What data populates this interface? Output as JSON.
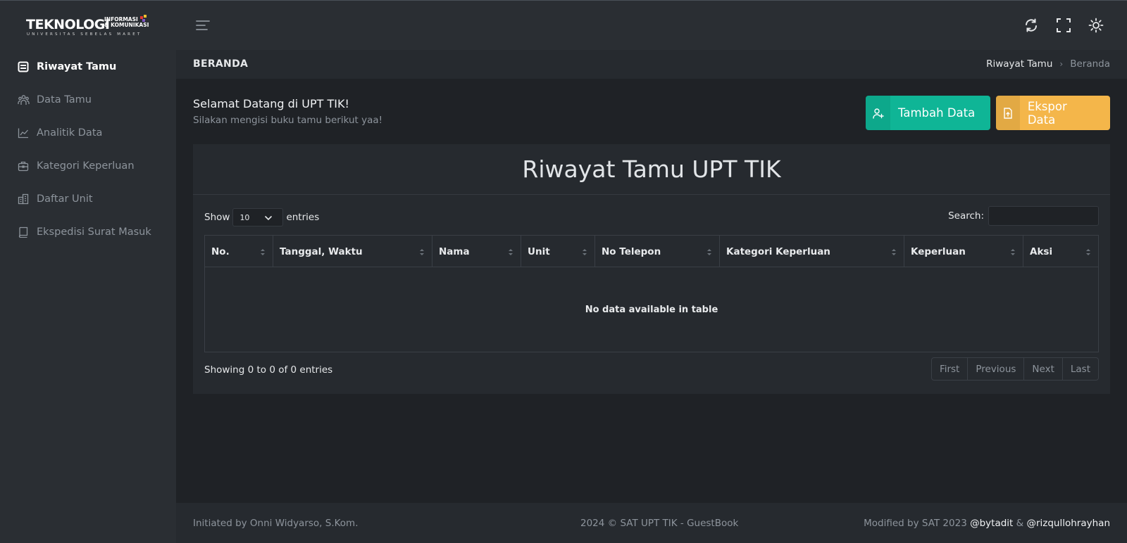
{
  "logo": {
    "main_text": "TEKNOLOGI",
    "side_text": "INFORMASI\n& KOMUNIKASI",
    "sub_text": "UNIVERSITAS SEBELAS MARET"
  },
  "sidebar": {
    "items": [
      {
        "label": "Riwayat Tamu",
        "icon": "guestbook-icon",
        "active": true
      },
      {
        "label": "Data Tamu",
        "icon": "users-icon",
        "active": false
      },
      {
        "label": "Analitik Data",
        "icon": "chart-line-icon",
        "active": false
      },
      {
        "label": "Kategori Keperluan",
        "icon": "briefcase-icon",
        "active": false
      },
      {
        "label": "Daftar Unit",
        "icon": "building-icon",
        "active": false
      },
      {
        "label": "Ekspedisi Surat Masuk",
        "icon": "book-icon",
        "active": false
      }
    ]
  },
  "topbar": {
    "icons": [
      "menu-icon",
      "refresh-icon",
      "fullscreen-icon",
      "theme-sun-icon"
    ]
  },
  "page": {
    "title": "BERANDA",
    "breadcrumb": [
      "Riwayat Tamu",
      "Beranda"
    ]
  },
  "welcome": {
    "heading": "Selamat Datang di UPT TIK!",
    "subtitle": "Silakan mengisi buku tamu berikut yaa!"
  },
  "actions": {
    "add_label": "Tambah Data",
    "export_label": "Ekspor Data"
  },
  "table": {
    "title": "Riwayat Tamu UPT TIK",
    "show_label": "Show",
    "entries_label": "entries",
    "page_size": "10",
    "search_label": "Search:",
    "search_value": "",
    "columns": [
      "No.",
      "Tanggal, Waktu",
      "Nama",
      "Unit",
      "No Telepon",
      "Kategori Keperluan",
      "Keperluan",
      "Aksi"
    ],
    "rows": [],
    "empty_text": "No data available in table",
    "info": "Showing 0 to 0 of 0 entries",
    "pagination": [
      "First",
      "Previous",
      "Next",
      "Last"
    ]
  },
  "footer": {
    "left": "Initiated by Onni Widyarso, S.Kom.",
    "center": "2024 © SAT UPT TIK - GuestBook",
    "right_prefix": "Modified by SAT 2023",
    "author1": "@bytadit",
    "amp": "&",
    "author2": "@rizqullohrayhan"
  },
  "colors": {
    "accent_green": "#0fb596",
    "accent_orange": "#f4b64a",
    "background": "#1f2226",
    "panel": "#262a2f"
  }
}
